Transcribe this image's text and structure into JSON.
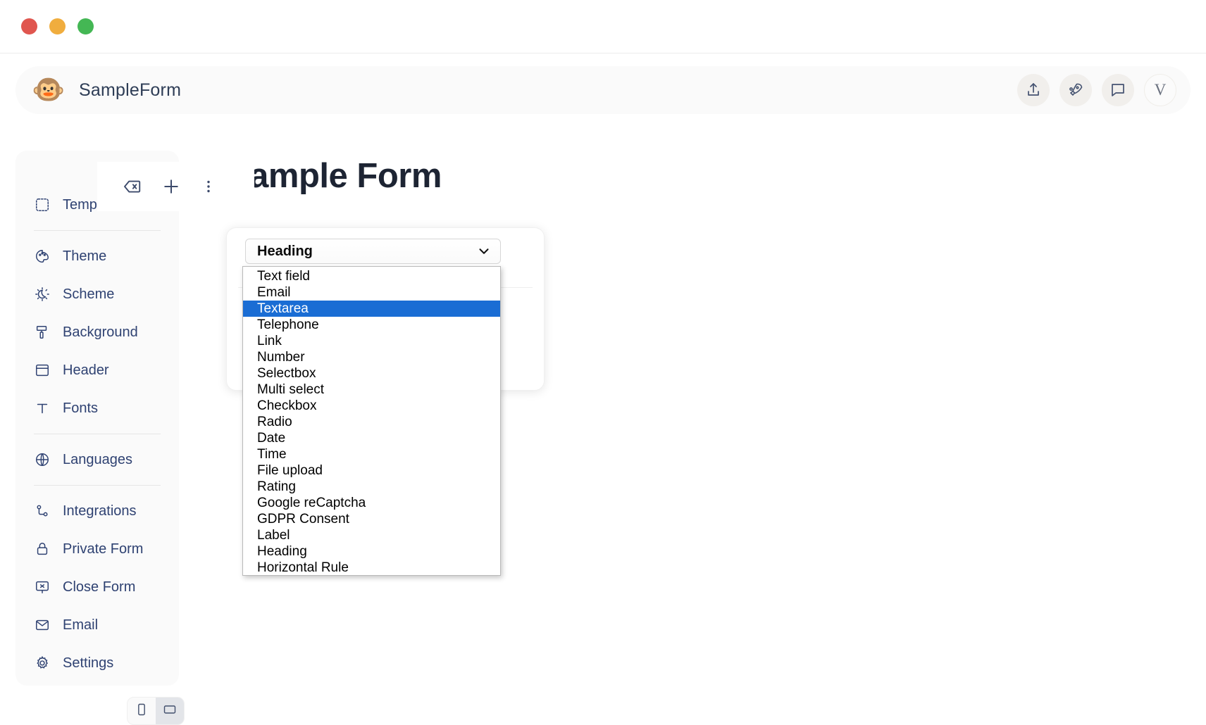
{
  "window": {
    "traffic_lights": [
      {
        "name": "close",
        "color": "#e0564f"
      },
      {
        "name": "minimize",
        "color": "#f0ad3e"
      },
      {
        "name": "maximize",
        "color": "#44b754"
      }
    ]
  },
  "header": {
    "logo_emoji": "🐵",
    "logo_name": "monkey-face-logo",
    "title": "SampleForm",
    "actions": [
      {
        "name": "share-icon",
        "label": "Share"
      },
      {
        "name": "publish-rocket-icon",
        "label": "Publish"
      },
      {
        "name": "feedback-chat-icon",
        "label": "Feedback"
      }
    ],
    "avatar_letter": "V"
  },
  "sidebar": {
    "code_icon_label": "<>",
    "groups": [
      {
        "items": [
          {
            "label": "Template",
            "icon": "template-icon"
          }
        ]
      },
      {
        "items": [
          {
            "label": "Theme",
            "icon": "palette-icon"
          },
          {
            "label": "Scheme",
            "icon": "sun-moon-icon"
          },
          {
            "label": "Background",
            "icon": "paint-roller-icon"
          },
          {
            "label": "Header",
            "icon": "header-layout-icon"
          },
          {
            "label": "Fonts",
            "icon": "font-type-icon"
          }
        ]
      },
      {
        "items": [
          {
            "label": "Languages",
            "icon": "globe-icon"
          }
        ]
      },
      {
        "items": [
          {
            "label": "Integrations",
            "icon": "integrations-icon"
          },
          {
            "label": "Private Form",
            "icon": "lock-icon"
          },
          {
            "label": "Close Form",
            "icon": "close-form-icon"
          },
          {
            "label": "Email",
            "icon": "envelope-icon"
          },
          {
            "label": "Settings",
            "icon": "gear-icon"
          }
        ]
      }
    ]
  },
  "device_toggle": {
    "options": [
      {
        "name": "mobile-view",
        "active": false
      },
      {
        "name": "desktop-view",
        "active": true
      }
    ]
  },
  "main": {
    "form_title": "Sample Form",
    "block_toolbar": [
      {
        "name": "delete-block-icon",
        "label": "Delete"
      },
      {
        "name": "add-block-icon",
        "label": "Add"
      },
      {
        "name": "more-options-icon",
        "label": "More"
      }
    ],
    "field_type_select": {
      "name": "field-type-select",
      "value": "Heading",
      "expanded": true,
      "highlighted": "Textarea",
      "options": [
        "Text field",
        "Email",
        "Textarea",
        "Telephone",
        "Link",
        "Number",
        "Selectbox",
        "Multi select",
        "Checkbox",
        "Radio",
        "Date",
        "Time",
        "File upload",
        "Rating",
        "Google reCaptcha",
        "GDPR Consent",
        "Label",
        "Heading",
        "Horizontal Rule"
      ]
    }
  },
  "colors": {
    "accent": "#1a6dd4",
    "nav_text": "#2f4272",
    "title": "#1d2433",
    "panel_bg": "#fafafa"
  }
}
